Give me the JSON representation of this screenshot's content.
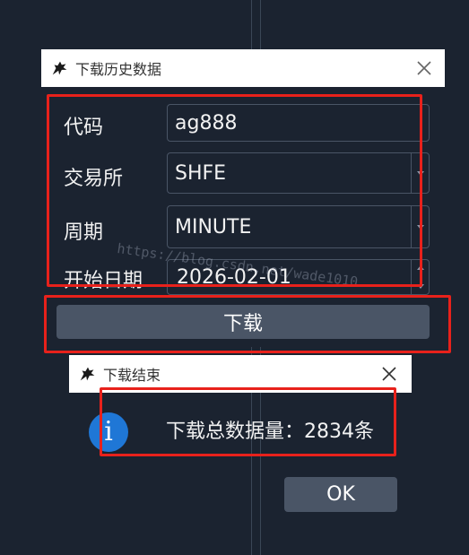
{
  "download_dialog": {
    "title": "下载历史数据",
    "fields": [
      {
        "label": "代码",
        "value": "ag888"
      },
      {
        "label": "交易所",
        "value": "SHFE"
      },
      {
        "label": "周期",
        "value": "MINUTE"
      },
      {
        "label": "开始日期",
        "value": "2026-02-01"
      }
    ],
    "download_label": "下载"
  },
  "result_dialog": {
    "title": "下载结束",
    "icon": "info-icon",
    "message": "下载总数据量：2834条",
    "ok_label": "OK"
  },
  "watermark": "https://blog.csdn.net/wade1010",
  "colors": {
    "background": "#1b2330",
    "button": "#4a5566",
    "highlight": "#e8211b",
    "info": "#1f77d6"
  }
}
